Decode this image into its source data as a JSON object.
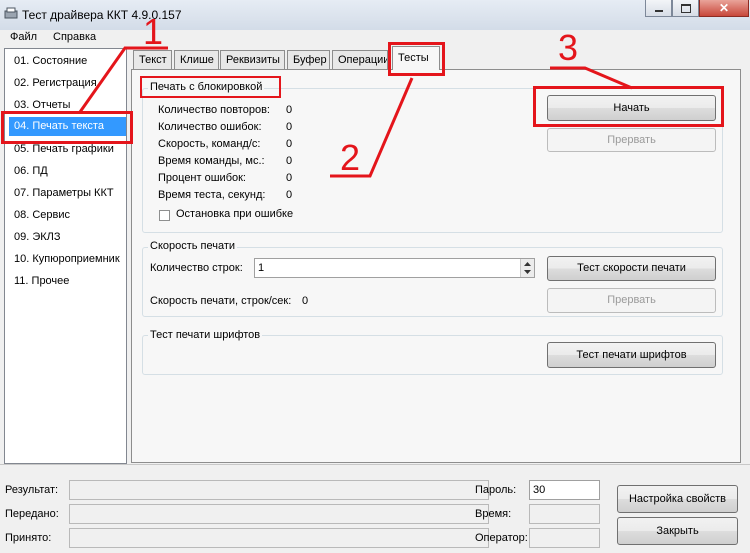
{
  "window": {
    "title": "Тест драйвера ККТ 4.9.0.157"
  },
  "menu": [
    "Файл",
    "Справка"
  ],
  "nav": {
    "items": [
      "01. Состояние",
      "02. Регистрация",
      "03. Отчеты",
      "04. Печать текста",
      "05. Печать графики",
      "06. ПД",
      "07. Параметры ККТ",
      "08. Сервис",
      "09. ЭКЛЗ",
      "10. Купюроприемник",
      "11. Прочее"
    ],
    "selected_index": 3
  },
  "tabs": [
    "Текст",
    "Клише",
    "Реквизиты",
    "Буфер",
    "Операции",
    "Тесты"
  ],
  "panel": {
    "group_block": {
      "title": "Печать с блокировкой",
      "stats": [
        {
          "label": "Количество повторов:",
          "value": "0"
        },
        {
          "label": "Количество ошибок:",
          "value": "0"
        },
        {
          "label": "Скорость, команд/с:",
          "value": "0"
        },
        {
          "label": "Время команды, мс.:",
          "value": "0"
        },
        {
          "label": "Процент ошибок:",
          "value": "0"
        },
        {
          "label": "Время теста, секунд:",
          "value": "0"
        }
      ],
      "stop_on_error_label": "Остановка при ошибке",
      "start_button": "Начать",
      "abort_button": "Прервать"
    },
    "group_speed": {
      "title": "Скорость печати",
      "lines_label": "Количество строк:",
      "lines_value": "1",
      "speed_label": "Скорость печати, строк/сек:",
      "speed_value": "0",
      "speed_test_button": "Тест скорости печати",
      "abort_button": "Прервать"
    },
    "group_fonts": {
      "title": "Тест печати шрифтов",
      "button": "Тест печати шрифтов"
    }
  },
  "bottom": {
    "result_label": "Результат:",
    "sent_label": "Передано:",
    "received_label": "Принято:",
    "password_label": "Пароль:",
    "password_value": "30",
    "time_label": "Время:",
    "operator_label": "Оператор:",
    "settings_button": "Настройка свойств",
    "close_button": "Закрыть"
  },
  "annotations": [
    "1",
    "2",
    "3"
  ],
  "colors": {
    "accent_selection": "#3399ff",
    "annotation_red": "#e4151b"
  }
}
